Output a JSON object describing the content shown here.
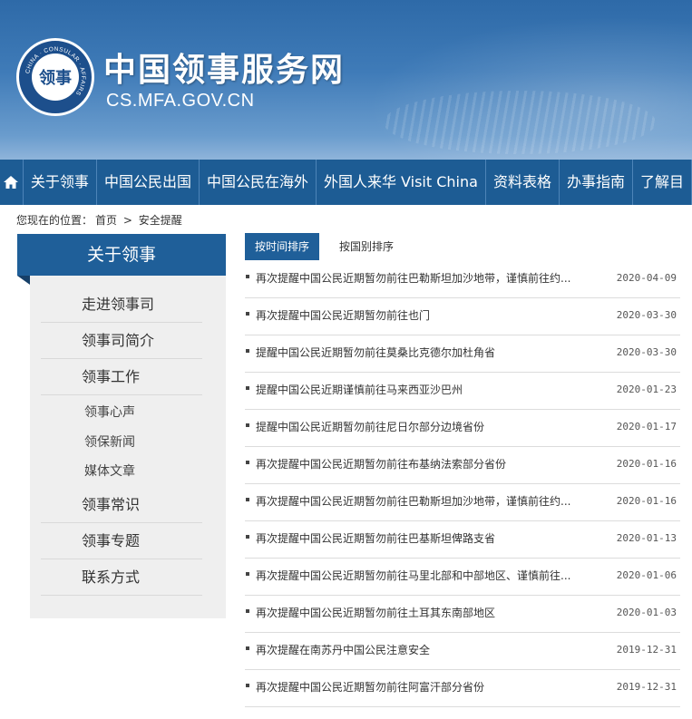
{
  "header": {
    "seal_text": "领事",
    "seal_ring_text": "CHINA · CONSULAR · AFFAIRS",
    "title": "中国领事服务网",
    "url": "CS.MFA.GOV.CN"
  },
  "nav": {
    "home_icon": "home-icon",
    "items": [
      "关于领事",
      "中国公民出国",
      "中国公民在海外",
      "外国人来华 Visit China",
      "资料表格",
      "办事指南",
      "了解目"
    ]
  },
  "breadcrumb": {
    "prefix": "您现在的位置：",
    "home": "首页",
    "separator": ">",
    "current": "安全提醒"
  },
  "sidebar": {
    "heading": "关于领事",
    "items": [
      {
        "label": "走进领事司"
      },
      {
        "label": "领事司简介"
      },
      {
        "label": "领事工作"
      }
    ],
    "subitems": [
      "领事心声",
      "领保新闻",
      "媒体文章"
    ],
    "items2": [
      {
        "label": "领事常识"
      },
      {
        "label": "领事专题"
      },
      {
        "label": "联系方式"
      }
    ]
  },
  "tabs": {
    "by_time": "按时间排序",
    "by_country": "按国别排序"
  },
  "list": [
    {
      "title": "再次提醒中国公民近期暂勿前往巴勒斯坦加沙地带，谨慎前往约...",
      "date": "2020-04-09"
    },
    {
      "title": "再次提醒中国公民近期暂勿前往也门",
      "date": "2020-03-30"
    },
    {
      "title": "提醒中国公民近期暂勿前往莫桑比克德尔加杜角省",
      "date": "2020-03-30"
    },
    {
      "title": "提醒中国公民近期谨慎前往马来西亚沙巴州",
      "date": "2020-01-23"
    },
    {
      "title": "提醒中国公民近期暂勿前往尼日尔部分边境省份",
      "date": "2020-01-17"
    },
    {
      "title": "再次提醒中国公民近期暂勿前往布基纳法索部分省份",
      "date": "2020-01-16"
    },
    {
      "title": "再次提醒中国公民近期暂勿前往巴勒斯坦加沙地带，谨慎前往约...",
      "date": "2020-01-16"
    },
    {
      "title": "再次提醒中国公民近期暂勿前往巴基斯坦俾路支省",
      "date": "2020-01-13"
    },
    {
      "title": "再次提醒中国公民近期暂勿前往马里北部和中部地区、谨慎前往...",
      "date": "2020-01-06"
    },
    {
      "title": "再次提醒中国公民近期暂勿前往土耳其东南部地区",
      "date": "2020-01-03"
    },
    {
      "title": "再次提醒在南苏丹中国公民注意安全",
      "date": "2019-12-31"
    },
    {
      "title": "再次提醒中国公民近期暂勿前往阿富汗部分省份",
      "date": "2019-12-31"
    }
  ]
}
